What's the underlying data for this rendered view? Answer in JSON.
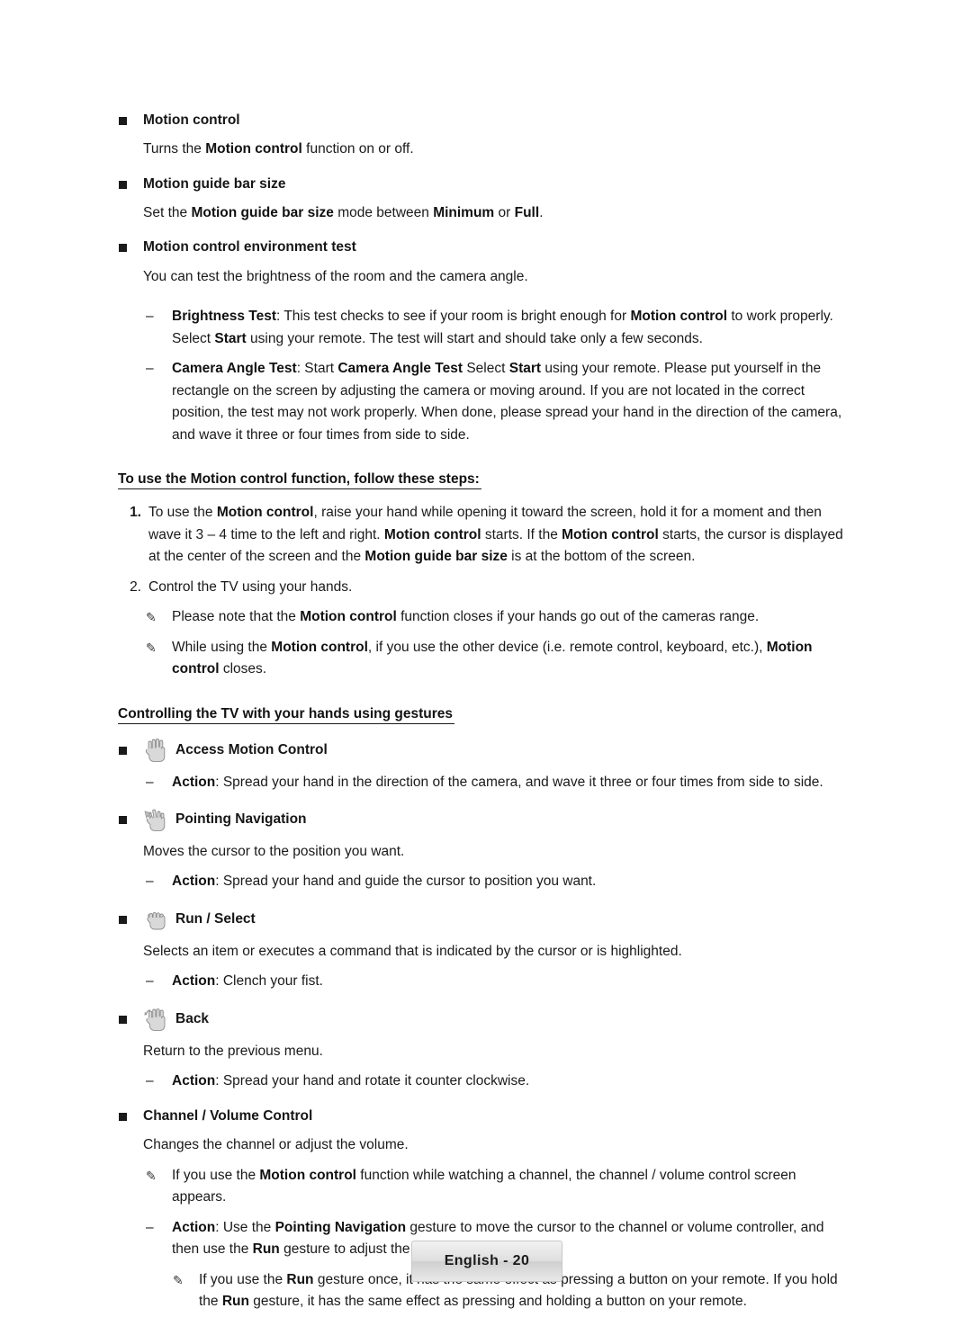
{
  "page": {
    "footer_label": "English - 20"
  },
  "sections": [
    {
      "heading": "Motion control",
      "body_html": "Turns the <b>Motion control</b> function on or off."
    },
    {
      "heading": "Motion guide bar size",
      "body_html": "Set the <b>Motion guide bar size</b> mode between <b>Minimum</b> or <b>Full</b>."
    },
    {
      "heading": "Motion control environment test",
      "body_html": "You can test the brightness of the room and the camera angle."
    }
  ],
  "env_test_items": [
    {
      "html": "<b>Brightness Test</b>: This test checks to see if your room is bright enough for <b>Motion control</b> to work properly. Select <b>Start</b> using your remote. The test will start and should take only a few seconds."
    },
    {
      "html": "<b>Camera Angle Test</b>: Start <b>Camera Angle Test</b> Select <b>Start</b> using your remote. Please put yourself in the rectangle on the screen by adjusting the camera or moving around. If you are not located in the correct position, the test may not work properly. When done, please spread your hand in the direction of the camera, and wave it three or four times from side to side."
    }
  ],
  "steps_section": {
    "title": "To use the Motion control function, follow these steps:",
    "items": [
      {
        "num": "1.",
        "bold_num": true,
        "html": "To use the <b>Motion control</b>, raise your hand while opening it toward the screen, hold it for a moment and then wave it 3 – 4 time to the left and right. <b>Motion control</b> starts. If the <b>Motion control</b> starts, the cursor is displayed at the center of the screen and the <b>Motion guide bar size</b> is at the bottom of the screen."
      },
      {
        "num": "2.",
        "bold_num": false,
        "html": "Control the TV using your hands."
      }
    ],
    "notes": [
      {
        "html": "Please note that the <b>Motion control</b> function closes if your hands go out of the cameras range."
      },
      {
        "html": "While using the <b>Motion control</b>, if you use the other device (i.e. remote control, keyboard, etc.), <b>Motion control</b> closes."
      }
    ]
  },
  "gestures_section": {
    "title": "Controlling the TV with your hands using gestures",
    "gestures": [
      {
        "icon": "open-hand-icon",
        "label": "Access Motion Control",
        "lines": [
          {
            "type": "dash",
            "html": "<b>Action</b>: Spread your hand in the direction of the camera, and wave it three or four times from side to side."
          }
        ]
      },
      {
        "icon": "pointing-hand-icon",
        "label": "Pointing Navigation",
        "lines": [
          {
            "type": "plain",
            "html": "Moves the cursor to the position you want."
          },
          {
            "type": "dash",
            "html": "<b>Action</b>: Spread your hand and guide the cursor to position you want."
          }
        ]
      },
      {
        "icon": "fist-hand-icon",
        "label": "Run / Select",
        "lines": [
          {
            "type": "plain",
            "html": "Selects an item or executes a command that is indicated by the cursor or is highlighted."
          },
          {
            "type": "dash",
            "html": "<b>Action</b>: Clench your fist."
          }
        ]
      },
      {
        "icon": "rotate-hand-icon",
        "label": "Back",
        "lines": [
          {
            "type": "plain",
            "html": "Return to the previous menu."
          },
          {
            "type": "dash",
            "html": "<b>Action</b>: Spread your hand and rotate it counter clockwise."
          }
        ]
      },
      {
        "icon": "none",
        "label": "Channel / Volume Control",
        "lines": [
          {
            "type": "plain",
            "html": "Changes the channel or adjust the volume."
          },
          {
            "type": "pencil",
            "html": "If you use the <b>Motion control</b> function while watching a channel, the channel / volume control screen appears."
          },
          {
            "type": "dash",
            "html": "<b>Action</b>: Use the <b>Pointing Navigation</b> gesture to move the cursor to the channel or volume controller, and then use the <b>Run</b> gesture to adjust the channel or volume."
          },
          {
            "type": "pencil-deep",
            "html": "If you use the <b>Run</b> gesture once, it has the same effect as pressing a button on your remote. If you hold the <b>Run</b> gesture, it has the same effect as pressing and holding a button on your remote."
          }
        ]
      }
    ]
  }
}
